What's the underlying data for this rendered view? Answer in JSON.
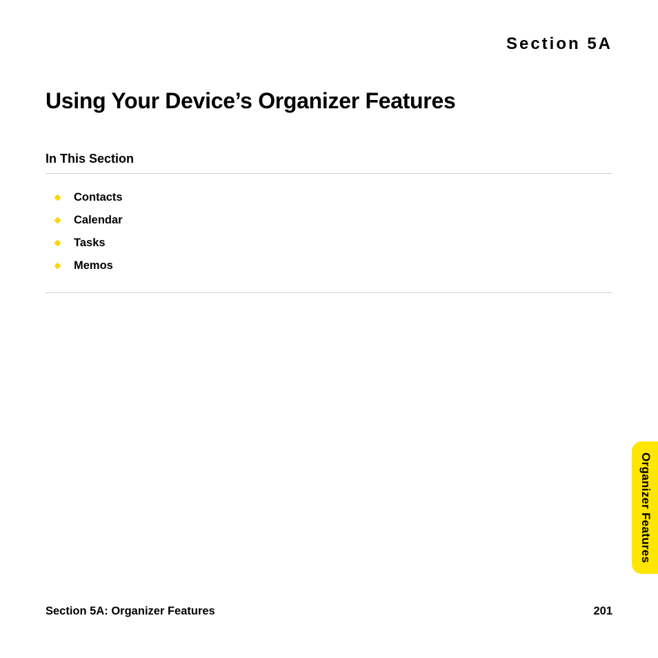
{
  "section_label": "Section 5A",
  "title": "Using Your Device’s Organizer Features",
  "subhead": "In This Section",
  "toc": [
    {
      "label": "Contacts"
    },
    {
      "label": "Calendar"
    },
    {
      "label": "Tasks"
    },
    {
      "label": "Memos"
    }
  ],
  "footer_left": "Section 5A: Organizer Features",
  "footer_right": "201",
  "side_tab": "Organizer Features"
}
